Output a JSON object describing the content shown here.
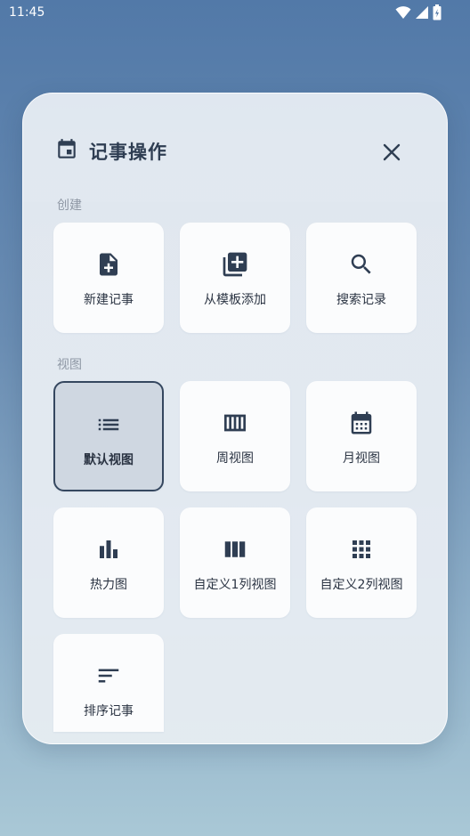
{
  "status_bar": {
    "time": "11:45",
    "icons": [
      "wifi-icon",
      "signal-icon",
      "battery-icon"
    ]
  },
  "dialog": {
    "title": "记事操作",
    "header_icon": "calendar-event-icon",
    "close_icon": "close-icon",
    "sections": [
      {
        "label": "创建",
        "items": [
          {
            "label": "新建记事",
            "icon": "note-add-icon"
          },
          {
            "label": "从模板添加",
            "icon": "library-add-icon"
          },
          {
            "label": "搜索记录",
            "icon": "search-icon"
          }
        ]
      },
      {
        "label": "视图",
        "items": [
          {
            "label": "默认视图",
            "icon": "list-icon",
            "selected": true
          },
          {
            "label": "周视图",
            "icon": "week-columns-icon"
          },
          {
            "label": "月视图",
            "icon": "calendar-month-icon"
          },
          {
            "label": "热力图",
            "icon": "bar-chart-icon"
          },
          {
            "label": "自定义1列视图",
            "icon": "view-column-icon"
          },
          {
            "label": "自定义2列视图",
            "icon": "apps-grid-icon"
          },
          {
            "label": "排序记事",
            "icon": "sort-icon"
          }
        ]
      }
    ]
  },
  "colors": {
    "icon": "#2f3e53",
    "selected_bg": "#cfd7e1",
    "selected_border": "#35475f",
    "tile_bg": "#fbfcfd"
  }
}
